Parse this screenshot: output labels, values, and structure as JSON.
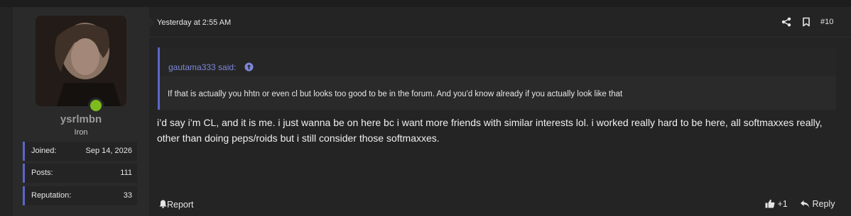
{
  "user": {
    "name": "ysrlmbn",
    "title": "Iron",
    "online_color": "#7dbb1f",
    "stats": [
      {
        "label": "Joined:",
        "value": "Sep 14, 2026"
      },
      {
        "label": "Posts:",
        "value": "111"
      },
      {
        "label": "Reputation:",
        "value": "33"
      }
    ]
  },
  "post": {
    "time": "Yesterday at 2:55 AM",
    "number": "#10",
    "quote": {
      "author": "gautama333 said:",
      "text": "If that is actually you hhtn or even cl but looks too good to be in the forum. And you'd know already if you actually look like that"
    },
    "body": "i’d say i’m CL, and it is me. i just wanna be on here bc i want more friends with similar interests lol. i worked really hard to be here, all softmaxxes really, other than doing peps/roids but i still consider those softmaxxes.",
    "actions": {
      "report": "Report",
      "like_count": "+1",
      "reply": "Reply"
    }
  },
  "colors": {
    "accent": "#5b66c8",
    "quote_author": "#7e86d9",
    "panel": "#242424",
    "sidebar": "#2a2a2a"
  }
}
